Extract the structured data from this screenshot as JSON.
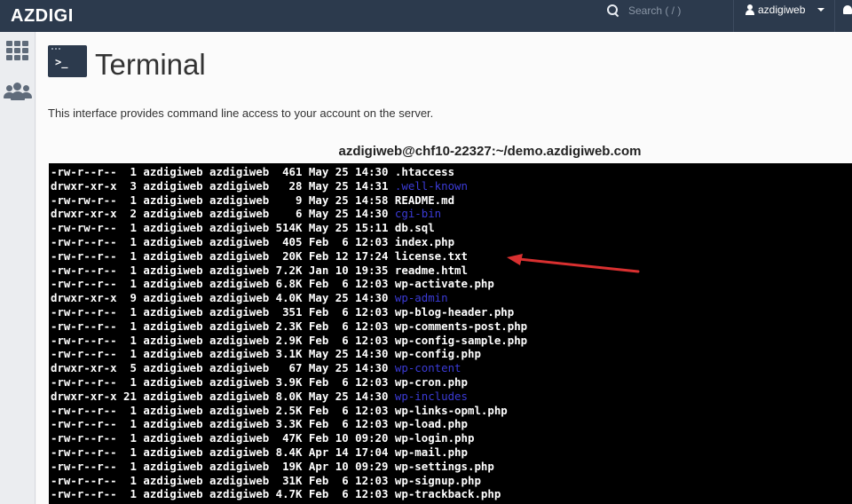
{
  "header": {
    "logo": "AZDIGI",
    "search_placeholder": "Search ( / )",
    "username": "azdigiweb"
  },
  "icons": {
    "search": "search-icon",
    "user": "user-icon",
    "caret": "caret-down-icon",
    "bell": "bell-icon",
    "apps": "grid-icon",
    "users": "users-icon",
    "terminal": "terminal-icon"
  },
  "page": {
    "title": "Terminal",
    "description": "This interface provides command line access to your account on the server.",
    "host": "azdigiweb@chf10-22327:~/demo.azdigiweb.com"
  },
  "terminal": {
    "lines": [
      {
        "prefix": "-rw-r--r--  1 azdigiweb azdigiweb  461 May 25 14:30 ",
        "name": ".htaccess",
        "dir": false
      },
      {
        "prefix": "drwxr-xr-x  3 azdigiweb azdigiweb   28 May 25 14:31 ",
        "name": ".well-known",
        "dir": true
      },
      {
        "prefix": "-rw-rw-r--  1 azdigiweb azdigiweb    9 May 25 14:58 ",
        "name": "README.md",
        "dir": false
      },
      {
        "prefix": "drwxr-xr-x  2 azdigiweb azdigiweb    6 May 25 14:30 ",
        "name": "cgi-bin",
        "dir": true
      },
      {
        "prefix": "-rw-rw-r--  1 azdigiweb azdigiweb 514K May 25 15:11 ",
        "name": "db.sql",
        "dir": false
      },
      {
        "prefix": "-rw-r--r--  1 azdigiweb azdigiweb  405 Feb  6 12:03 ",
        "name": "index.php",
        "dir": false
      },
      {
        "prefix": "-rw-r--r--  1 azdigiweb azdigiweb  20K Feb 12 17:24 ",
        "name": "license.txt",
        "dir": false
      },
      {
        "prefix": "-rw-r--r--  1 azdigiweb azdigiweb 7.2K Jan 10 19:35 ",
        "name": "readme.html",
        "dir": false
      },
      {
        "prefix": "-rw-r--r--  1 azdigiweb azdigiweb 6.8K Feb  6 12:03 ",
        "name": "wp-activate.php",
        "dir": false
      },
      {
        "prefix": "drwxr-xr-x  9 azdigiweb azdigiweb 4.0K May 25 14:30 ",
        "name": "wp-admin",
        "dir": true
      },
      {
        "prefix": "-rw-r--r--  1 azdigiweb azdigiweb  351 Feb  6 12:03 ",
        "name": "wp-blog-header.php",
        "dir": false
      },
      {
        "prefix": "-rw-r--r--  1 azdigiweb azdigiweb 2.3K Feb  6 12:03 ",
        "name": "wp-comments-post.php",
        "dir": false
      },
      {
        "prefix": "-rw-r--r--  1 azdigiweb azdigiweb 2.9K Feb  6 12:03 ",
        "name": "wp-config-sample.php",
        "dir": false
      },
      {
        "prefix": "-rw-r--r--  1 azdigiweb azdigiweb 3.1K May 25 14:30 ",
        "name": "wp-config.php",
        "dir": false
      },
      {
        "prefix": "drwxr-xr-x  5 azdigiweb azdigiweb   67 May 25 14:30 ",
        "name": "wp-content",
        "dir": true
      },
      {
        "prefix": "-rw-r--r--  1 azdigiweb azdigiweb 3.9K Feb  6 12:03 ",
        "name": "wp-cron.php",
        "dir": false
      },
      {
        "prefix": "drwxr-xr-x 21 azdigiweb azdigiweb 8.0K May 25 14:30 ",
        "name": "wp-includes",
        "dir": true
      },
      {
        "prefix": "-rw-r--r--  1 azdigiweb azdigiweb 2.5K Feb  6 12:03 ",
        "name": "wp-links-opml.php",
        "dir": false
      },
      {
        "prefix": "-rw-r--r--  1 azdigiweb azdigiweb 3.3K Feb  6 12:03 ",
        "name": "wp-load.php",
        "dir": false
      },
      {
        "prefix": "-rw-r--r--  1 azdigiweb azdigiweb  47K Feb 10 09:20 ",
        "name": "wp-login.php",
        "dir": false
      },
      {
        "prefix": "-rw-r--r--  1 azdigiweb azdigiweb 8.4K Apr 14 17:04 ",
        "name": "wp-mail.php",
        "dir": false
      },
      {
        "prefix": "-rw-r--r--  1 azdigiweb azdigiweb  19K Apr 10 09:29 ",
        "name": "wp-settings.php",
        "dir": false
      },
      {
        "prefix": "-rw-r--r--  1 azdigiweb azdigiweb  31K Feb  6 12:03 ",
        "name": "wp-signup.php",
        "dir": false
      },
      {
        "prefix": "-rw-r--r--  1 azdigiweb azdigiweb 4.7K Feb  6 12:03 ",
        "name": "wp-trackback.php",
        "dir": false
      }
    ]
  },
  "colors": {
    "topbar": "#2c3a4d",
    "terminal_bg": "#000000",
    "directory": "#3b3bd6",
    "arrow": "#d93030"
  }
}
